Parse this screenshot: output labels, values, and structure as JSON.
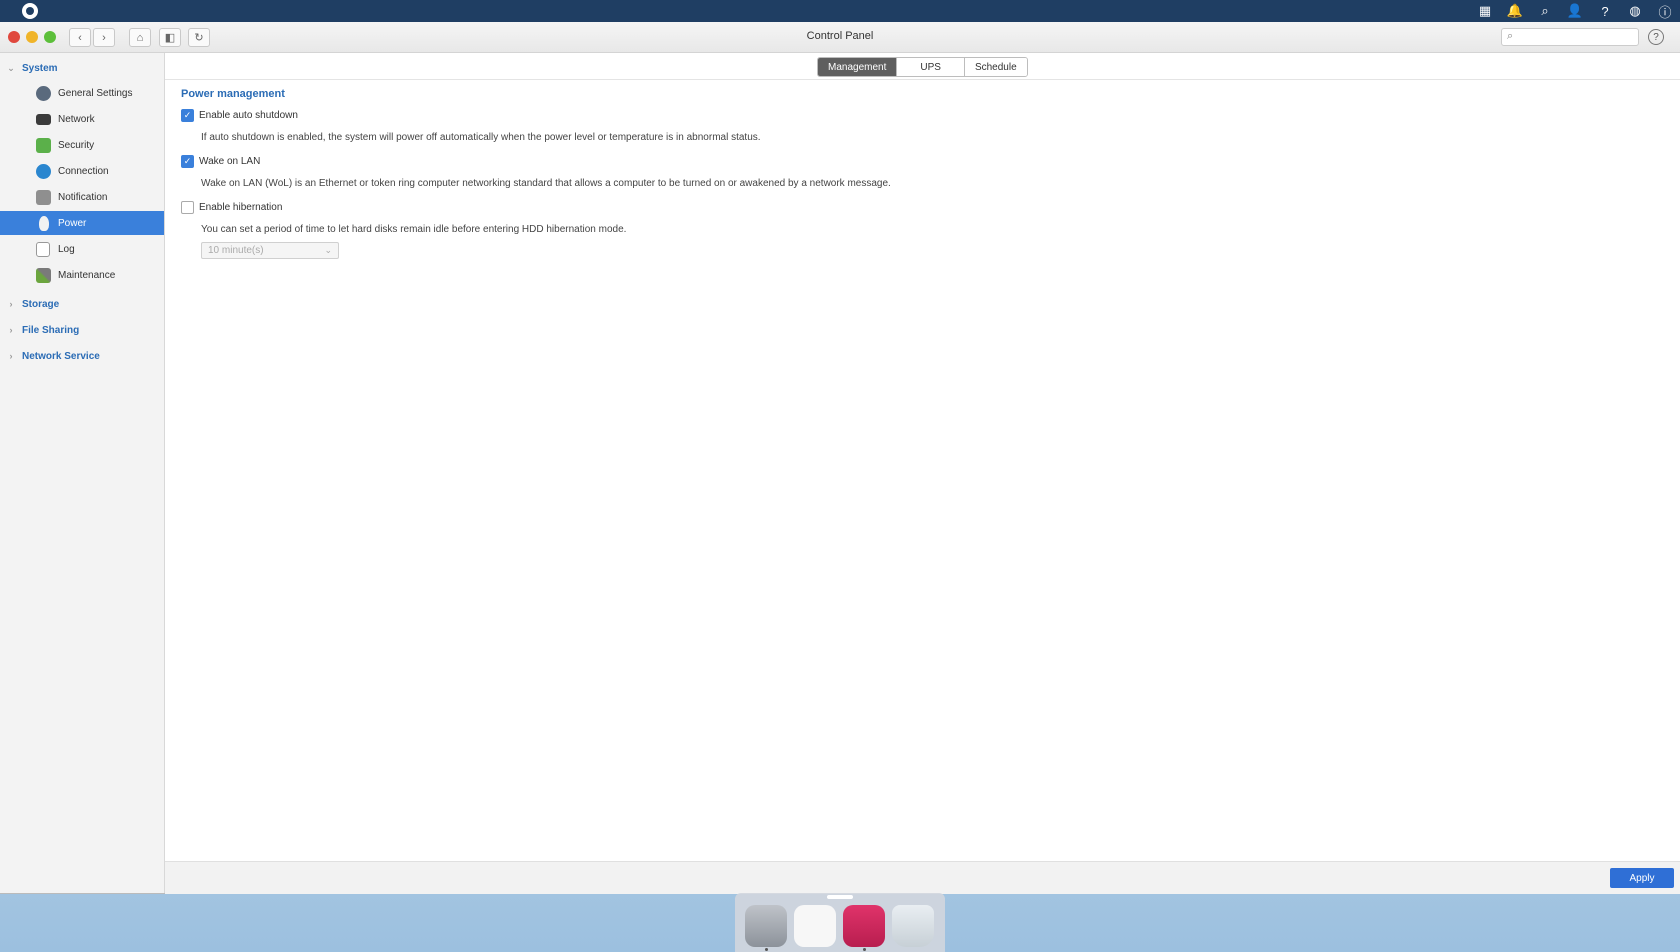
{
  "window": {
    "title": "Control Panel",
    "search_placeholder": ""
  },
  "sidebar": {
    "sections": [
      {
        "label": "System",
        "expanded": true
      },
      {
        "label": "Storage",
        "expanded": false
      },
      {
        "label": "File Sharing",
        "expanded": false
      },
      {
        "label": "Network Service",
        "expanded": false
      }
    ],
    "items": [
      {
        "label": "General Settings",
        "icon": "gear-icon"
      },
      {
        "label": "Network",
        "icon": "network-icon"
      },
      {
        "label": "Security",
        "icon": "lock-icon"
      },
      {
        "label": "Connection",
        "icon": "globe-icon"
      },
      {
        "label": "Notification",
        "icon": "bell-icon"
      },
      {
        "label": "Power",
        "icon": "bulb-icon",
        "active": true
      },
      {
        "label": "Log",
        "icon": "log-icon"
      },
      {
        "label": "Maintenance",
        "icon": "tools-icon"
      }
    ]
  },
  "tabs": [
    {
      "label": "Management",
      "active": true
    },
    {
      "label": "UPS"
    },
    {
      "label": "Schedule"
    }
  ],
  "main": {
    "section_title": "Power management",
    "options": [
      {
        "label": "Enable auto shutdown",
        "checked": true,
        "description": "If auto shutdown is enabled, the system will power off automatically when the power level or temperature is in abnormal status."
      },
      {
        "label": "Wake on LAN",
        "checked": true,
        "description": "Wake on LAN (WoL) is an Ethernet or token ring computer networking standard that allows a computer to be turned on or awakened by a network message."
      },
      {
        "label": "Enable hibernation",
        "checked": false,
        "description": "You can set a period of time to let hard disks remain idle before entering HDD hibernation mode."
      }
    ],
    "hibernation_select": {
      "value": "10 minute(s)",
      "disabled": true
    },
    "apply_label": "Apply"
  },
  "colors": {
    "accent": "#3a80db",
    "topbar": "#1f3e63",
    "apply": "#2f6fd6"
  }
}
